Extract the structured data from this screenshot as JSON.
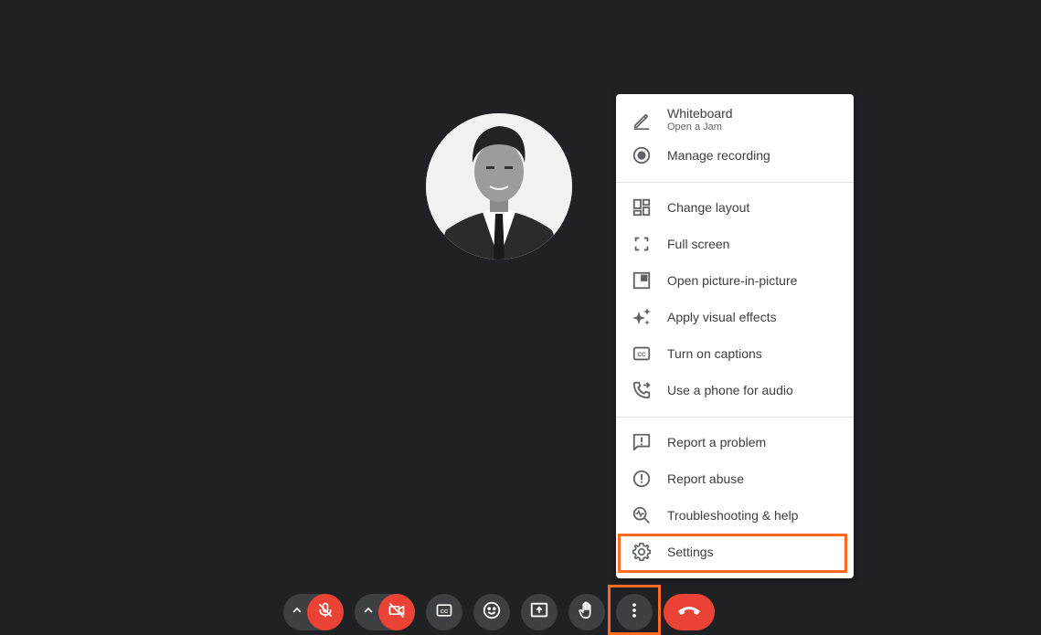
{
  "menu": {
    "items": [
      {
        "label": "Whiteboard",
        "sublabel": "Open a Jam",
        "icon": "pencil-icon"
      },
      {
        "label": "Manage recording",
        "icon": "record-icon"
      },
      {
        "label": "Change layout",
        "icon": "layout-icon"
      },
      {
        "label": "Full screen",
        "icon": "fullscreen-icon"
      },
      {
        "label": "Open picture-in-picture",
        "icon": "picture-in-picture-icon"
      },
      {
        "label": "Apply visual effects",
        "icon": "sparkle-icon"
      },
      {
        "label": "Turn on captions",
        "icon": "captions-icon"
      },
      {
        "label": "Use a phone for audio",
        "icon": "phone-forward-icon"
      },
      {
        "label": "Report a problem",
        "icon": "feedback-icon"
      },
      {
        "label": "Report abuse",
        "icon": "report-icon"
      },
      {
        "label": "Troubleshooting & help",
        "icon": "troubleshoot-icon"
      },
      {
        "label": "Settings",
        "icon": "gear-icon"
      }
    ],
    "highlighted_item": "Settings"
  },
  "controls": [
    {
      "name": "microphone",
      "state": "muted",
      "icon": "mic-off-icon"
    },
    {
      "name": "camera",
      "state": "off",
      "icon": "camera-off-icon"
    },
    {
      "name": "captions",
      "icon": "captions-icon"
    },
    {
      "name": "reactions",
      "icon": "emoji-icon"
    },
    {
      "name": "present",
      "icon": "present-icon"
    },
    {
      "name": "raise-hand",
      "icon": "hand-icon"
    },
    {
      "name": "more-options",
      "icon": "more-vert-icon",
      "highlighted": true
    },
    {
      "name": "leave-call",
      "icon": "end-call-icon"
    }
  ],
  "colors": {
    "background": "#202124",
    "menu_bg": "#ffffff",
    "control_bg": "#3c4043",
    "danger": "#ea4335",
    "highlight": "#ff6a21",
    "text": "#3c4043",
    "icon": "#5f6368"
  }
}
